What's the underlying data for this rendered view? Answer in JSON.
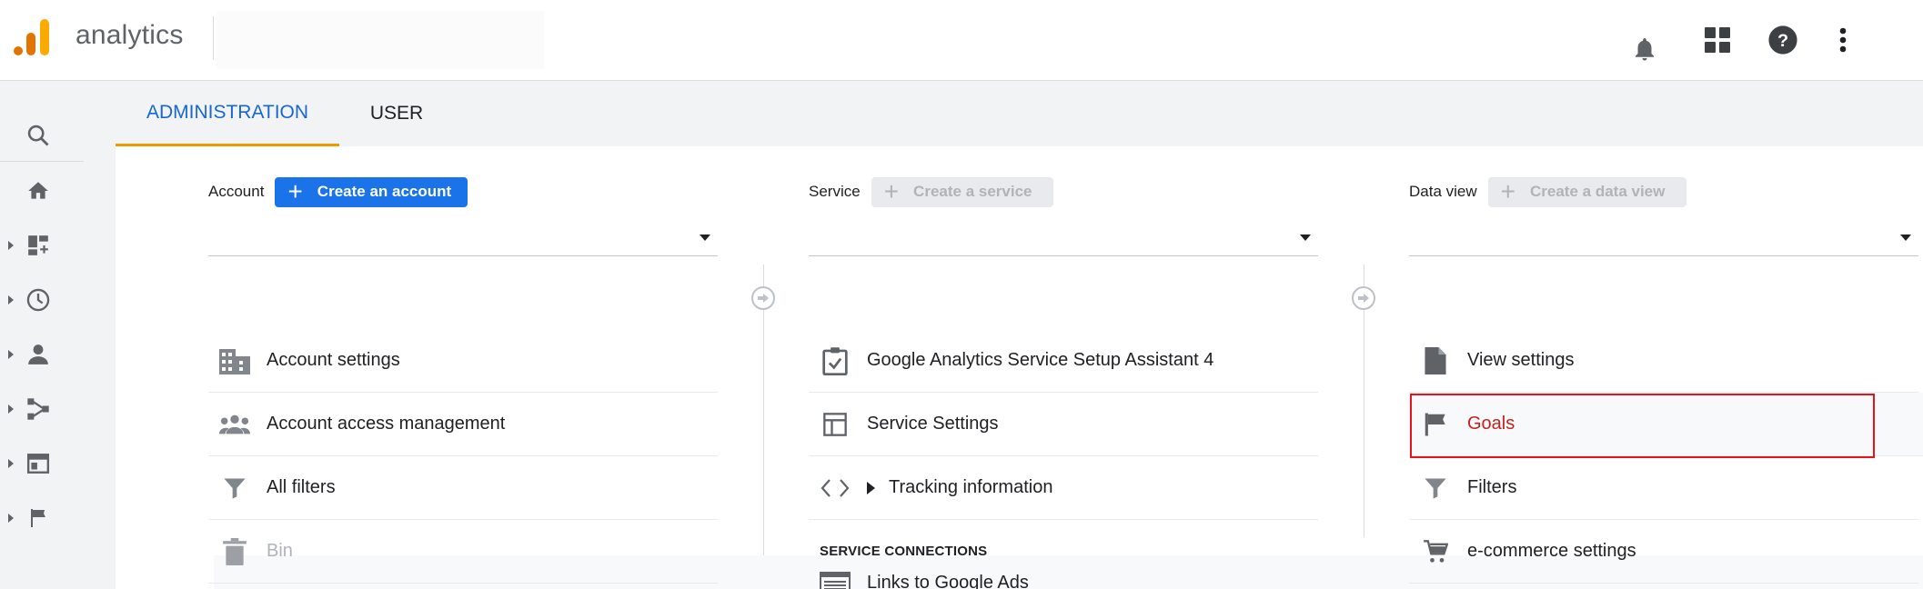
{
  "app": {
    "brand": "analytics"
  },
  "colors": {
    "accent": "#1a73e8",
    "tab_active": "#1967d2",
    "tab_underline": "#f29900",
    "logo_orange": "#f9ab00",
    "logo_dark": "#e37400",
    "highlight": "#e8131a"
  },
  "topbar": {
    "icons": [
      "notifications-icon",
      "apps-grid-icon",
      "help-icon",
      "more-vert-icon"
    ]
  },
  "leftrail": {
    "items": [
      "search-icon",
      "home-icon",
      "customization-icon",
      "realtime-icon",
      "audience-icon",
      "acquisition-icon",
      "behavior-icon",
      "conversions-icon"
    ]
  },
  "tabs": [
    {
      "label": "ADMINISTRATION",
      "active": true
    },
    {
      "label": "USER",
      "active": false
    }
  ],
  "account": {
    "label": "Account",
    "create_button": "Create an account",
    "items": [
      {
        "label": "Account settings",
        "icon": "building-icon"
      },
      {
        "label": "Account access management",
        "icon": "people-icon"
      },
      {
        "label": "All filters",
        "icon": "filter-icon"
      },
      {
        "label": "Bin",
        "icon": "trash-icon",
        "disabled": true
      }
    ]
  },
  "service": {
    "label": "Service",
    "create_button": "Create a service",
    "items": [
      {
        "label": "Google Analytics Service Setup Assistant 4",
        "icon": "checklist-icon"
      },
      {
        "label": "Service Settings",
        "icon": "layout-icon"
      },
      {
        "label": "Tracking information",
        "icon": "code-icon"
      }
    ],
    "section_heading": "SERVICE CONNECTIONS",
    "connections": [
      {
        "label": "Links to Google Ads",
        "icon": "ads-icon"
      }
    ]
  },
  "dataview": {
    "label": "Data view",
    "create_button": "Create a data view",
    "items": [
      {
        "label": "View settings",
        "icon": "document-icon"
      },
      {
        "label": "Goals",
        "icon": "flag-icon",
        "highlighted": true
      },
      {
        "label": "Filters",
        "icon": "filter-icon"
      },
      {
        "label": "e-commerce settings",
        "icon": "cart-icon"
      }
    ]
  }
}
